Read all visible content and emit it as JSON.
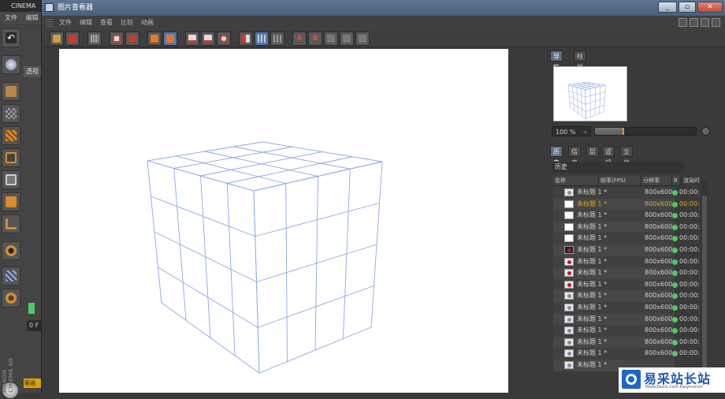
{
  "background_app": {
    "title": "CINEMA",
    "menu": [
      "文件",
      "编辑"
    ],
    "viewport_label": "透视",
    "frame_field": "0 F",
    "material_label": "案通",
    "brand": "MAXON CINEMA 4D"
  },
  "viewer": {
    "title": "图片查看器",
    "menu": [
      "文件",
      "编辑",
      "查看",
      "比较",
      "动画"
    ],
    "window_buttons": {
      "minimize": "_",
      "restore": "▫",
      "close": "✕"
    },
    "toolbar_letters": {
      "a": "A",
      "b": "B"
    }
  },
  "navigator": {
    "tabs": [
      "导航器",
      "柱状图"
    ],
    "zoom_value": "100 %",
    "zoom_spinner": "÷",
    "zoom_fraction": 0.27
  },
  "history": {
    "tabs": [
      "历史",
      "信息",
      "层",
      "滤镜",
      "立体"
    ],
    "header": "历史",
    "columns": [
      "名称",
      "帧率(FPS)",
      "分辨率",
      "R",
      "渲染时"
    ],
    "rows": [
      {
        "name": "未标题 1 *",
        "resolution": "800x600",
        "time": "00:00:",
        "thumb": "render",
        "highlight": false
      },
      {
        "name": "未标题 1 *",
        "resolution": "800x600",
        "time": "00:00:",
        "thumb": "white",
        "highlight": true
      },
      {
        "name": "未标题 1 *",
        "resolution": "800x600",
        "time": "00:00:",
        "thumb": "white",
        "highlight": false
      },
      {
        "name": "未标题 1 *",
        "resolution": "800x600",
        "time": "00:00:",
        "thumb": "white",
        "highlight": false
      },
      {
        "name": "未标题 1 *",
        "resolution": "800x600",
        "time": "00:00:",
        "thumb": "white",
        "highlight": false
      },
      {
        "name": "未标题 1 *",
        "resolution": "800x600",
        "time": "00:00:",
        "thumb": "red-dark",
        "highlight": false
      },
      {
        "name": "未标题 1 *",
        "resolution": "800x600",
        "time": "00:00:",
        "thumb": "red",
        "highlight": false
      },
      {
        "name": "未标题 1 *",
        "resolution": "800x600",
        "time": "00:00:",
        "thumb": "red",
        "highlight": false
      },
      {
        "name": "未标题 1 *",
        "resolution": "800x600",
        "time": "00:00:",
        "thumb": "red",
        "highlight": false
      },
      {
        "name": "未标题 1 *",
        "resolution": "800x600",
        "time": "00:00:",
        "thumb": "render",
        "highlight": false
      },
      {
        "name": "未标题 1 *",
        "resolution": "800x600",
        "time": "00:00:",
        "thumb": "render",
        "highlight": false
      },
      {
        "name": "未标题 1 *",
        "resolution": "800x600",
        "time": "00:00:",
        "thumb": "render",
        "highlight": false
      },
      {
        "name": "未标题 1 *",
        "resolution": "800x600",
        "time": "00:00:",
        "thumb": "render",
        "highlight": false
      },
      {
        "name": "未标题 1 *",
        "resolution": "800x600",
        "time": "00:00:",
        "thumb": "render",
        "highlight": false
      },
      {
        "name": "未标题 1 *",
        "resolution": "800x600",
        "time": "00:00:",
        "thumb": "render",
        "highlight": false
      },
      {
        "name": "未标题 1 *",
        "resolution": "",
        "time": "",
        "thumb": "render",
        "highlight": false
      }
    ]
  },
  "colors": {
    "accent_tab": "#5a6f86",
    "highlight_text": "#e8a417",
    "status_green": "#4ccb62",
    "wireframe": "#8fa6e8"
  },
  "watermark": {
    "title": "易采站长站",
    "url": "Www.Easck.Com  Easymorion"
  }
}
